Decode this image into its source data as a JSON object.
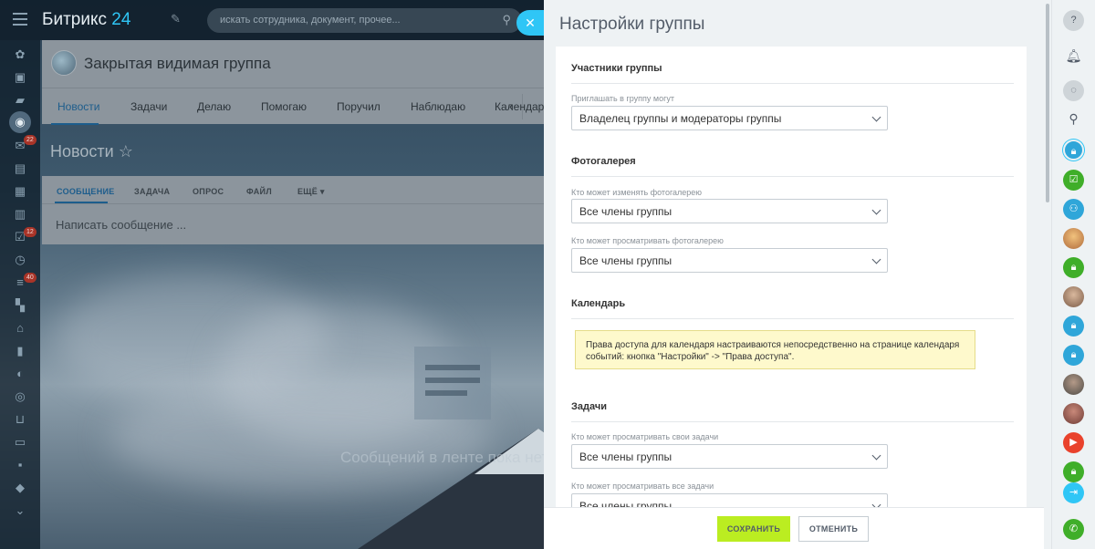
{
  "app": {
    "logo_brand": "Битрикс",
    "logo_number": "24",
    "search": {
      "placeholder": "искать сотрудника, документ, прочее..."
    },
    "badges": {
      "mail": "22",
      "tasks": "12",
      "feed": "40"
    },
    "icons": [
      "live-feed-icon",
      "chat-icon",
      "groups-icon",
      "mail-icon",
      "drive-icon",
      "calendar-icon",
      "docs-icon",
      "tasks-icon",
      "time-icon",
      "crm-icon",
      "apps-icon",
      "store-icon",
      "reports-icon",
      "sites-icon",
      "marketing-icon",
      "shop-icon",
      "contact-center-icon",
      "id-card-icon",
      "database-icon",
      "more-icon"
    ]
  },
  "group": {
    "title": "Закрытая видимая группа",
    "tabs": [
      "Новости",
      "Задачи",
      "Делаю",
      "Помогаю",
      "Поручил",
      "Наблюдаю",
      "Календарь"
    ],
    "active_tab": "Новости"
  },
  "feed": {
    "title": "Новости",
    "composer_tabs": [
      "СООБЩЕНИЕ",
      "ЗАДАЧА",
      "ОПРОС",
      "ФАЙЛ",
      "ЕЩЁ"
    ],
    "composer_placeholder": "Написать сообщение ...",
    "empty_text": "Сообщений в ленте пока нет"
  },
  "settings": {
    "title": "Настройки группы",
    "sections": {
      "members": {
        "title": "Участники группы",
        "invite_label": "Приглашать в группу могут",
        "invite_value": "Владелец группы и модераторы группы"
      },
      "gallery": {
        "title": "Фотогалерея",
        "edit_label": "Кто может изменять фотогалерею",
        "edit_value": "Все члены группы",
        "view_label": "Кто может просматривать фотогалерею",
        "view_value": "Все члены группы"
      },
      "calendar": {
        "title": "Календарь",
        "note": "Права доступа для календаря настраиваются непосредственно на странице календаря событий: кнопка \"Настройки\" -> \"Права доступа\"."
      },
      "tasks": {
        "title": "Задачи",
        "view_own_label": "Кто может просматривать свои задачи",
        "view_own_value": "Все члены группы",
        "view_all_label": "Кто может просматривать все задачи",
        "view_all_value": "Все члены группы"
      }
    },
    "save_label": "СОХРАНИТЬ",
    "cancel_label": "ОТМЕНИТЬ"
  },
  "colors": {
    "accent": "#2fc6f6",
    "save_button": "#bbed21",
    "note_background": "#fef9cc"
  }
}
